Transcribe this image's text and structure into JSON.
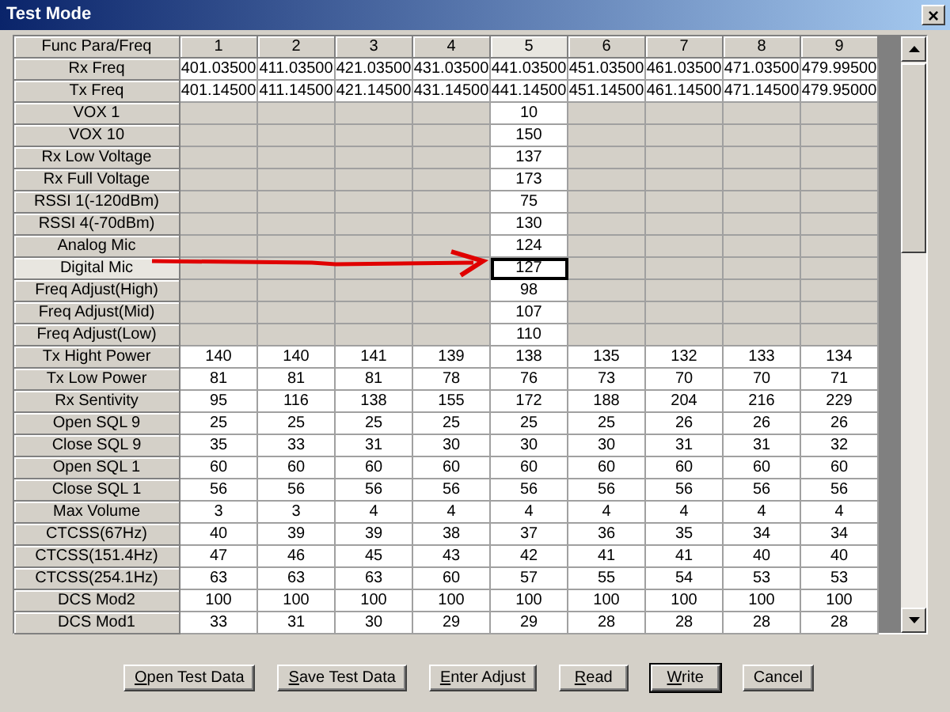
{
  "window": {
    "title": "Test Mode",
    "close": "×"
  },
  "table": {
    "corner": "Func Para/Freq",
    "columns": [
      {
        "label": "1",
        "selected": false
      },
      {
        "label": "2",
        "selected": false
      },
      {
        "label": "3",
        "selected": false
      },
      {
        "label": "4",
        "selected": false
      },
      {
        "label": "5",
        "selected": true
      },
      {
        "label": "6",
        "selected": false
      },
      {
        "label": "7",
        "selected": false
      },
      {
        "label": "8",
        "selected": false
      },
      {
        "label": "9",
        "selected": false
      }
    ],
    "rows": [
      {
        "label": "Rx Freq",
        "selected": false,
        "cells": [
          "401.03500",
          "411.03500",
          "421.03500",
          "431.03500",
          "441.03500",
          "451.03500",
          "461.03500",
          "471.03500",
          "479.99500"
        ]
      },
      {
        "label": "Tx Freq",
        "selected": false,
        "cells": [
          "401.14500",
          "411.14500",
          "421.14500",
          "431.14500",
          "441.14500",
          "451.14500",
          "461.14500",
          "471.14500",
          "479.95000"
        ]
      },
      {
        "label": "VOX 1",
        "selected": false,
        "cells": [
          null,
          null,
          null,
          null,
          "10",
          null,
          null,
          null,
          null
        ]
      },
      {
        "label": "VOX 10",
        "selected": false,
        "cells": [
          null,
          null,
          null,
          null,
          "150",
          null,
          null,
          null,
          null
        ]
      },
      {
        "label": "Rx Low Voltage",
        "selected": false,
        "cells": [
          null,
          null,
          null,
          null,
          "137",
          null,
          null,
          null,
          null
        ]
      },
      {
        "label": "Rx Full Voltage",
        "selected": false,
        "cells": [
          null,
          null,
          null,
          null,
          "173",
          null,
          null,
          null,
          null
        ]
      },
      {
        "label": "RSSI 1(-120dBm)",
        "selected": false,
        "cells": [
          null,
          null,
          null,
          null,
          "75",
          null,
          null,
          null,
          null
        ]
      },
      {
        "label": "RSSI 4(-70dBm)",
        "selected": false,
        "cells": [
          null,
          null,
          null,
          null,
          "130",
          null,
          null,
          null,
          null
        ]
      },
      {
        "label": "Analog Mic",
        "selected": false,
        "cells": [
          null,
          null,
          null,
          null,
          "124",
          null,
          null,
          null,
          null
        ]
      },
      {
        "label": "Digital Mic",
        "selected": true,
        "cells": [
          null,
          null,
          null,
          null,
          "127",
          null,
          null,
          null,
          null
        ]
      },
      {
        "label": "Freq Adjust(High)",
        "selected": false,
        "cells": [
          null,
          null,
          null,
          null,
          "98",
          null,
          null,
          null,
          null
        ]
      },
      {
        "label": "Freq Adjust(Mid)",
        "selected": false,
        "cells": [
          null,
          null,
          null,
          null,
          "107",
          null,
          null,
          null,
          null
        ]
      },
      {
        "label": "Freq Adjust(Low)",
        "selected": false,
        "cells": [
          null,
          null,
          null,
          null,
          "110",
          null,
          null,
          null,
          null
        ]
      },
      {
        "label": "Tx Hight Power",
        "selected": false,
        "cells": [
          "140",
          "140",
          "141",
          "139",
          "138",
          "135",
          "132",
          "133",
          "134"
        ]
      },
      {
        "label": "Tx Low Power",
        "selected": false,
        "cells": [
          "81",
          "81",
          "81",
          "78",
          "76",
          "73",
          "70",
          "70",
          "71"
        ]
      },
      {
        "label": "Rx Sentivity",
        "selected": false,
        "cells": [
          "95",
          "116",
          "138",
          "155",
          "172",
          "188",
          "204",
          "216",
          "229"
        ]
      },
      {
        "label": "Open SQL 9",
        "selected": false,
        "cells": [
          "25",
          "25",
          "25",
          "25",
          "25",
          "25",
          "26",
          "26",
          "26"
        ]
      },
      {
        "label": "Close SQL 9",
        "selected": false,
        "cells": [
          "35",
          "33",
          "31",
          "30",
          "30",
          "30",
          "31",
          "31",
          "32"
        ]
      },
      {
        "label": "Open SQL 1",
        "selected": false,
        "cells": [
          "60",
          "60",
          "60",
          "60",
          "60",
          "60",
          "60",
          "60",
          "60"
        ]
      },
      {
        "label": "Close SQL 1",
        "selected": false,
        "cells": [
          "56",
          "56",
          "56",
          "56",
          "56",
          "56",
          "56",
          "56",
          "56"
        ]
      },
      {
        "label": "Max Volume",
        "selected": false,
        "cells": [
          "3",
          "3",
          "4",
          "4",
          "4",
          "4",
          "4",
          "4",
          "4"
        ]
      },
      {
        "label": "CTCSS(67Hz)",
        "selected": false,
        "cells": [
          "40",
          "39",
          "39",
          "38",
          "37",
          "36",
          "35",
          "34",
          "34"
        ]
      },
      {
        "label": "CTCSS(151.4Hz)",
        "selected": false,
        "cells": [
          "47",
          "46",
          "45",
          "43",
          "42",
          "41",
          "41",
          "40",
          "40"
        ]
      },
      {
        "label": "CTCSS(254.1Hz)",
        "selected": false,
        "cells": [
          "63",
          "63",
          "63",
          "60",
          "57",
          "55",
          "54",
          "53",
          "53"
        ]
      },
      {
        "label": "DCS Mod2",
        "selected": false,
        "cells": [
          "100",
          "100",
          "100",
          "100",
          "100",
          "100",
          "100",
          "100",
          "100"
        ]
      },
      {
        "label": "DCS Mod1",
        "selected": false,
        "cells": [
          "33",
          "31",
          "30",
          "29",
          "29",
          "28",
          "28",
          "28",
          "28"
        ]
      }
    ]
  },
  "annotation_arrow": true,
  "buttons": [
    {
      "label": "Open Test Data",
      "mnemonic": true,
      "default": false
    },
    {
      "label": "Save Test Data",
      "mnemonic": true,
      "default": false
    },
    {
      "label": "Enter Adjust",
      "mnemonic": true,
      "default": false
    },
    {
      "label": "Read",
      "mnemonic": true,
      "default": false
    },
    {
      "label": "Write",
      "mnemonic": true,
      "default": true
    },
    {
      "label": "Cancel",
      "mnemonic": false,
      "default": false
    }
  ]
}
